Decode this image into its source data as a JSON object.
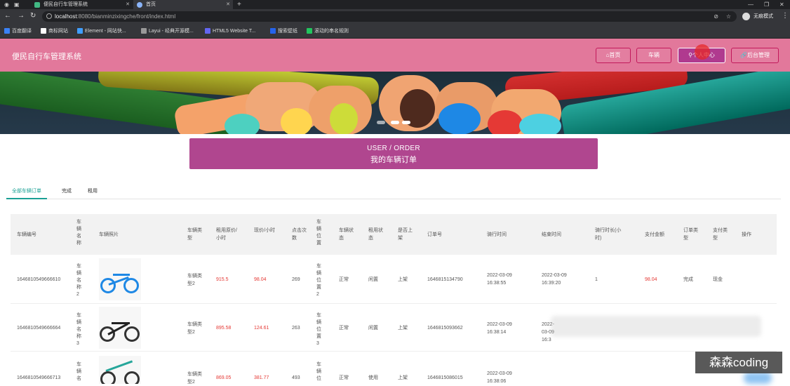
{
  "browser": {
    "tabs": [
      {
        "title": "便民自行车管理系统"
      },
      {
        "title": "首页"
      }
    ],
    "url_host": "localhost",
    "url_rest": ":8080/bianminzixingche/front/index.html",
    "incognito_label": "无痕模式",
    "bookmarks": [
      {
        "label": "百度翻译",
        "color": "#3b82f6"
      },
      {
        "label": "商标网站",
        "color": "#ffffff"
      },
      {
        "label": "Element - 网站快...",
        "color": "#409eff"
      },
      {
        "label": "Layui - 经典开源模...",
        "color": "#999999"
      },
      {
        "label": "HTML5 Website T...",
        "color": "#6366f1"
      },
      {
        "label": "搜索壁纸",
        "color": "#2563eb"
      },
      {
        "label": "滚动的串名规则",
        "color": "#22c55e"
      }
    ]
  },
  "header": {
    "title": "便民自行车管理系统",
    "nav": [
      {
        "label": "首页",
        "icon": "home-icon"
      },
      {
        "label": "车辆",
        "icon": ""
      },
      {
        "label": "个人中心",
        "icon": "user-icon"
      },
      {
        "label": "后台管理",
        "icon": "link-icon"
      }
    ],
    "bg_color": "#e2789b"
  },
  "section": {
    "title_en": "USER / ORDER",
    "title_zh": "我的车辆订单"
  },
  "order_tabs": [
    "全部车辆订单",
    "完成",
    "租用"
  ],
  "table": {
    "headers": [
      "车辆编号",
      "车辆名称",
      "车辆照片",
      "车辆类型",
      "租用原价/小时",
      "现价/小时",
      "点击次数",
      "车辆位置",
      "车辆状态",
      "租用状态",
      "是否上架",
      "订单号",
      "骑行时间",
      "结束时间",
      "骑行时长(小时)",
      "支付金额",
      "订单类型",
      "支付类型",
      "操作"
    ],
    "rows": [
      {
        "id": "1646810549666610",
        "name": "车辆名称2",
        "type": "车辆类型2",
        "orig": "915.5",
        "price": "98.04",
        "clicks": "269",
        "loc": "车辆位置2",
        "status": "正常",
        "rent": "闲置",
        "shelf": "上架",
        "order": "1646815134790",
        "start": "2022-03-09 16:38:55",
        "end": "2022-03-09 16:39:20",
        "dur": "1",
        "pay": "98.04",
        "otype": "完成",
        "ptype": "现金"
      },
      {
        "id": "1646810549666664",
        "name": "车辆名称3",
        "type": "车辆类型2",
        "orig": "895.58",
        "price": "124.61",
        "clicks": "263",
        "loc": "车辆位置3",
        "status": "正常",
        "rent": "闲置",
        "shelf": "上架",
        "order": "1646815093662",
        "start": "2022-03-09 16:38:14",
        "end": "2022-03-09 16:3",
        "dur": "",
        "pay": "",
        "otype": "",
        "ptype": ""
      },
      {
        "id": "1646810549666713",
        "name": "车辆名",
        "type": "车辆类型2",
        "orig": "869.05",
        "price": "381.77",
        "clicks": "493",
        "loc": "车辆位",
        "status": "正常",
        "rent": "使用",
        "shelf": "上架",
        "order": "1646815086015",
        "start": "2022-03-09 16:38:06",
        "end": "",
        "dur": "",
        "pay": "",
        "otype": "",
        "ptype": ""
      }
    ]
  },
  "watermark": "森森coding"
}
